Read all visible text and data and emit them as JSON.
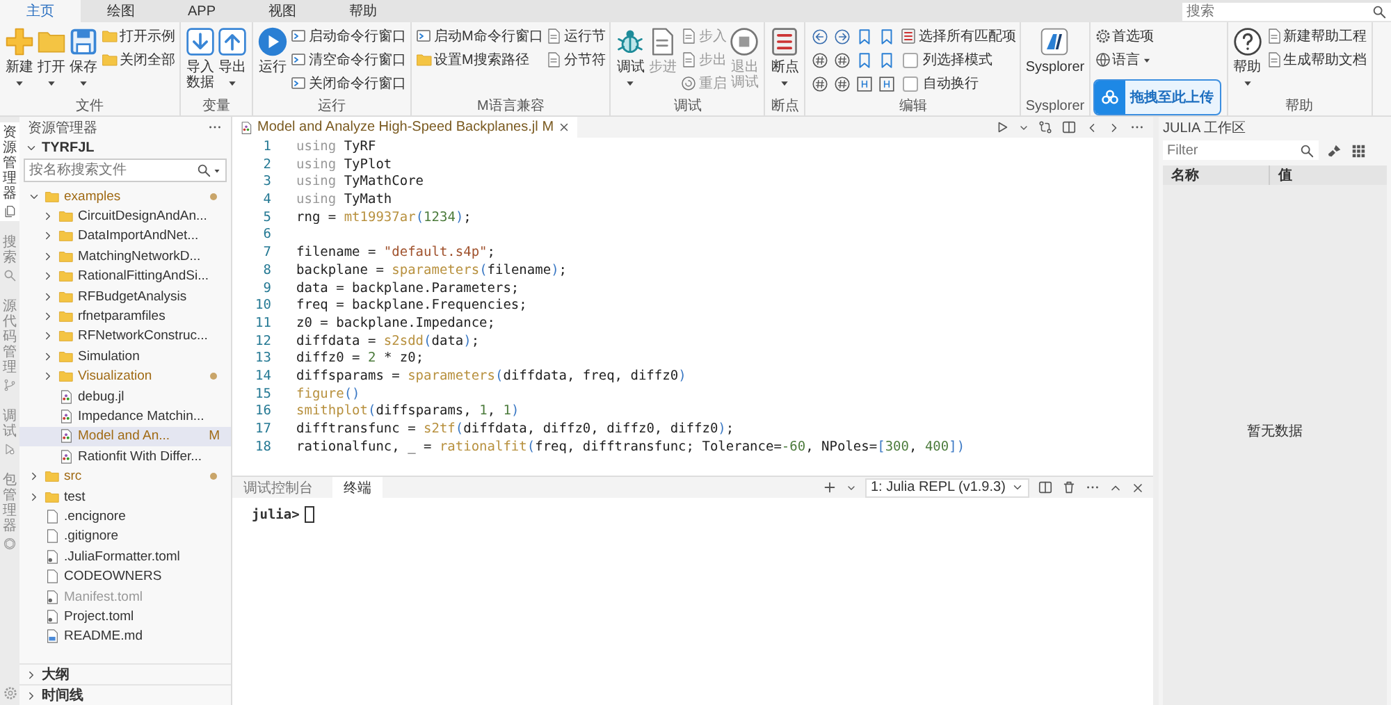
{
  "menu_tabs": [
    {
      "label": "主页",
      "selected": true
    },
    {
      "label": "绘图",
      "selected": false
    },
    {
      "label": "APP",
      "selected": false
    },
    {
      "label": "视图",
      "selected": false
    },
    {
      "label": "帮助",
      "selected": false
    }
  ],
  "search": {
    "placeholder": "搜索"
  },
  "ribbon": {
    "groups": [
      {
        "label": "文件",
        "columns": [
          {
            "kind": "large",
            "items": [
              {
                "label": "新建",
                "dropdown": true,
                "disabled": false
              },
              {
                "label": "打开",
                "dropdown": true,
                "disabled": false
              },
              {
                "label": "保存",
                "dropdown": true,
                "disabled": false
              }
            ]
          },
          {
            "kind": "small",
            "items": [
              {
                "label": "打开示例",
                "disabled": false
              },
              {
                "label": "关闭全部",
                "disabled": false
              }
            ]
          }
        ]
      },
      {
        "label": "变量",
        "columns": [
          {
            "kind": "large",
            "items": [
              {
                "label": "导入数据",
                "disabled": false
              },
              {
                "label": "导出",
                "dropdown": true,
                "disabled": false
              }
            ]
          }
        ]
      },
      {
        "label": "运行",
        "columns": [
          {
            "kind": "large",
            "items": [
              {
                "label": "运行",
                "disabled": false
              }
            ]
          },
          {
            "kind": "small",
            "items": [
              {
                "label": "启动命令行窗口",
                "disabled": false
              },
              {
                "label": "清空命令行窗口",
                "disabled": false
              },
              {
                "label": "关闭命令行窗口",
                "disabled": false
              }
            ]
          }
        ]
      },
      {
        "label": "M语言兼容",
        "columns": [
          {
            "kind": "small",
            "items": [
              {
                "label": "启动M命令行窗口",
                "disabled": false
              },
              {
                "label": "设置M搜索路径",
                "disabled": false
              }
            ]
          },
          {
            "kind": "small",
            "items": [
              {
                "label": "运行节",
                "disabled": false
              },
              {
                "label": "分节符",
                "disabled": false
              }
            ]
          }
        ]
      },
      {
        "label": "调试",
        "columns": [
          {
            "kind": "large",
            "items": [
              {
                "label": "调试",
                "dropdown": true,
                "disabled": false
              },
              {
                "label": "步进",
                "disabled": true
              }
            ]
          },
          {
            "kind": "small",
            "items": [
              {
                "label": "步入",
                "disabled": true
              },
              {
                "label": "步出",
                "disabled": true
              },
              {
                "label": "重启",
                "disabled": true
              }
            ]
          },
          {
            "kind": "large",
            "items": [
              {
                "label": "退出调试",
                "disabled": true
              }
            ]
          }
        ]
      },
      {
        "label": "断点",
        "columns": [
          {
            "kind": "large",
            "items": [
              {
                "label": "断点",
                "dropdown": true,
                "disabled": false
              }
            ]
          }
        ]
      },
      {
        "label": "编辑",
        "columns": [
          {
            "kind": "icons"
          },
          {
            "kind": "small",
            "items": [
              {
                "kind": "button",
                "label": "选择所有匹配项",
                "disabled": false
              },
              {
                "kind": "check",
                "label": "列选择模式",
                "checked": false
              },
              {
                "kind": "check",
                "label": "自动换行",
                "checked": false
              }
            ]
          }
        ]
      },
      {
        "label": "Sysplorer",
        "columns": [
          {
            "kind": "large",
            "items": [
              {
                "label": "Sysplorer",
                "disabled": false
              }
            ]
          }
        ]
      },
      {
        "columns": [
          {
            "kind": "small",
            "items": [
              {
                "label": "首选项",
                "disabled": false
              },
              {
                "label": "语言",
                "dropdown": true,
                "disabled": false
              }
            ]
          }
        ]
      },
      {
        "label": "帮助",
        "columns": [
          {
            "kind": "large",
            "items": [
              {
                "label": "帮助",
                "dropdown": true,
                "disabled": false
              }
            ]
          },
          {
            "kind": "small",
            "items": [
              {
                "label": "新建帮助工程",
                "disabled": false
              },
              {
                "label": "生成帮助文档",
                "disabled": false
              }
            ]
          }
        ]
      }
    ]
  },
  "upload_badge": {
    "label": "拖拽至此上传"
  },
  "activity_bar": [
    {
      "label": "资源管理器",
      "selected": true
    },
    {
      "label": "搜索",
      "selected": false
    },
    {
      "label": "源代码管理",
      "selected": false
    },
    {
      "label": "调试",
      "selected": false
    },
    {
      "label": "包管理器",
      "selected": false
    }
  ],
  "explorer": {
    "title": "资源管理器",
    "root": {
      "label": "TYRFJL",
      "expanded": true
    },
    "search": {
      "placeholder": "按名称搜索文件"
    },
    "tree": [
      {
        "kind": "folder",
        "label": "examples",
        "expanded": true,
        "selected": false,
        "modified": true,
        "dimmed": false,
        "children": [
          {
            "kind": "folder",
            "label": "CircuitDesignAndAn...",
            "expanded": false,
            "selected": false,
            "modified": false,
            "dimmed": false
          },
          {
            "kind": "folder",
            "label": "DataImportAndNet...",
            "expanded": false,
            "selected": false,
            "modified": false,
            "dimmed": false
          },
          {
            "kind": "folder",
            "label": "MatchingNetworkD...",
            "expanded": false,
            "selected": false,
            "modified": false,
            "dimmed": false
          },
          {
            "kind": "folder",
            "label": "RationalFittingAndSi...",
            "expanded": false,
            "selected": false,
            "modified": false,
            "dimmed": false
          },
          {
            "kind": "folder",
            "label": "RFBudgetAnalysis",
            "expanded": false,
            "selected": false,
            "modified": false,
            "dimmed": false
          },
          {
            "kind": "folder",
            "label": "rfnetparamfiles",
            "expanded": false,
            "selected": false,
            "modified": false,
            "dimmed": false
          },
          {
            "kind": "folder",
            "label": "RFNetworkConstruc...",
            "expanded": false,
            "selected": false,
            "modified": false,
            "dimmed": false
          },
          {
            "kind": "folder",
            "label": "Simulation",
            "expanded": false,
            "selected": false,
            "modified": false,
            "dimmed": false
          },
          {
            "kind": "folder",
            "label": "Visualization",
            "expanded": false,
            "selected": false,
            "modified": true,
            "dimmed": false
          },
          {
            "kind": "julia",
            "label": "debug.jl",
            "selected": false,
            "modified": false,
            "dimmed": false
          },
          {
            "kind": "julia",
            "label": "Impedance Matchin...",
            "selected": false,
            "modified": false,
            "dimmed": false
          },
          {
            "kind": "julia",
            "label": "Model and An...",
            "badge": "M",
            "selected": true,
            "modified": true,
            "dimmed": false
          },
          {
            "kind": "julia",
            "label": "Rationfit With Differ...",
            "selected": false,
            "modified": false,
            "dimmed": false
          }
        ]
      },
      {
        "kind": "folder",
        "label": "src",
        "expanded": false,
        "selected": false,
        "modified": true,
        "dimmed": false
      },
      {
        "kind": "folder",
        "label": "test",
        "expanded": false,
        "selected": false,
        "modified": false,
        "dimmed": false
      },
      {
        "kind": "file",
        "label": ".encignore",
        "selected": false,
        "modified": false,
        "dimmed": false
      },
      {
        "kind": "file",
        "label": ".gitignore",
        "selected": false,
        "modified": false,
        "dimmed": false
      },
      {
        "kind": "config",
        "label": ".JuliaFormatter.toml",
        "selected": false,
        "modified": false,
        "dimmed": false
      },
      {
        "kind": "file",
        "label": "CODEOWNERS",
        "selected": false,
        "modified": false,
        "dimmed": false
      },
      {
        "kind": "config",
        "label": "Manifest.toml",
        "selected": false,
        "modified": false,
        "dimmed": true
      },
      {
        "kind": "config",
        "label": "Project.toml",
        "selected": false,
        "modified": false,
        "dimmed": false
      },
      {
        "kind": "markdown",
        "label": "README.md",
        "selected": false,
        "modified": false,
        "dimmed": false
      }
    ],
    "sections": [
      {
        "label": "大纲",
        "expanded": false
      },
      {
        "label": "时间线",
        "expanded": false
      }
    ]
  },
  "editor": {
    "tab": {
      "title": "Model and Analyze High-Speed Backplanes.jl",
      "badge": "M"
    },
    "lines": [
      {
        "number": "1",
        "tokens": [
          {
            "kind": "kw",
            "text": "using"
          },
          {
            "kind": "plain",
            "text": " TyRF"
          }
        ]
      },
      {
        "number": "2",
        "tokens": [
          {
            "kind": "kw",
            "text": "using"
          },
          {
            "kind": "plain",
            "text": " TyPlot"
          }
        ]
      },
      {
        "number": "3",
        "tokens": [
          {
            "kind": "kw",
            "text": "using"
          },
          {
            "kind": "plain",
            "text": " TyMathCore"
          }
        ]
      },
      {
        "number": "4",
        "tokens": [
          {
            "kind": "kw",
            "text": "using"
          },
          {
            "kind": "plain",
            "text": " TyMath"
          }
        ]
      },
      {
        "number": "5",
        "tokens": [
          {
            "kind": "plain",
            "text": "rng = "
          },
          {
            "kind": "fn",
            "text": "mt19937ar"
          },
          {
            "kind": "paren",
            "text": "("
          },
          {
            "kind": "num",
            "text": "1234"
          },
          {
            "kind": "paren",
            "text": ")"
          },
          {
            "kind": "plain",
            "text": ";"
          }
        ]
      },
      {
        "number": "6"
      },
      {
        "number": "7",
        "tokens": [
          {
            "kind": "plain",
            "text": "filename = "
          },
          {
            "kind": "str",
            "text": "\"default.s4p\""
          },
          {
            "kind": "plain",
            "text": ";"
          }
        ]
      },
      {
        "number": "8",
        "tokens": [
          {
            "kind": "plain",
            "text": "backplane = "
          },
          {
            "kind": "fn",
            "text": "sparameters"
          },
          {
            "kind": "paren",
            "text": "("
          },
          {
            "kind": "plain",
            "text": "filename"
          },
          {
            "kind": "paren",
            "text": ")"
          },
          {
            "kind": "plain",
            "text": ";"
          }
        ]
      },
      {
        "number": "9",
        "tokens": [
          {
            "kind": "plain",
            "text": "data = backplane.Parameters;"
          }
        ]
      },
      {
        "number": "10",
        "tokens": [
          {
            "kind": "plain",
            "text": "freq = backplane.Frequencies;"
          }
        ]
      },
      {
        "number": "11",
        "tokens": [
          {
            "kind": "plain",
            "text": "z0 = backplane.Impedance;"
          }
        ]
      },
      {
        "number": "12",
        "tokens": [
          {
            "kind": "plain",
            "text": "diffdata = "
          },
          {
            "kind": "fn",
            "text": "s2sdd"
          },
          {
            "kind": "paren",
            "text": "("
          },
          {
            "kind": "plain",
            "text": "data"
          },
          {
            "kind": "paren",
            "text": ")"
          },
          {
            "kind": "plain",
            "text": ";"
          }
        ]
      },
      {
        "number": "13",
        "tokens": [
          {
            "kind": "plain",
            "text": "diffz0 = "
          },
          {
            "kind": "num",
            "text": "2"
          },
          {
            "kind": "plain",
            "text": " * z0;"
          }
        ]
      },
      {
        "number": "14",
        "tokens": [
          {
            "kind": "plain",
            "text": "diffsparams = "
          },
          {
            "kind": "fn",
            "text": "sparameters"
          },
          {
            "kind": "paren",
            "text": "("
          },
          {
            "kind": "plain",
            "text": "diffdata, freq, diffz0"
          },
          {
            "kind": "paren",
            "text": ")"
          }
        ]
      },
      {
        "number": "15",
        "tokens": [
          {
            "kind": "fn",
            "text": "figure"
          },
          {
            "kind": "paren",
            "text": "()"
          }
        ]
      },
      {
        "number": "16",
        "tokens": [
          {
            "kind": "fn",
            "text": "smithplot"
          },
          {
            "kind": "paren",
            "text": "("
          },
          {
            "kind": "plain",
            "text": "diffsparams, "
          },
          {
            "kind": "num",
            "text": "1"
          },
          {
            "kind": "plain",
            "text": ", "
          },
          {
            "kind": "num",
            "text": "1"
          },
          {
            "kind": "paren",
            "text": ")"
          }
        ]
      },
      {
        "number": "17",
        "tokens": [
          {
            "kind": "plain",
            "text": "difftransfunc = "
          },
          {
            "kind": "fn",
            "text": "s2tf"
          },
          {
            "kind": "paren",
            "text": "("
          },
          {
            "kind": "plain",
            "text": "diffdata, diffz0, diffz0, diffz0"
          },
          {
            "kind": "paren",
            "text": ")"
          },
          {
            "kind": "plain",
            "text": ";"
          }
        ]
      },
      {
        "number": "18",
        "tokens": [
          {
            "kind": "plain",
            "text": "rationalfunc, _ = "
          },
          {
            "kind": "fn",
            "text": "rationalfit"
          },
          {
            "kind": "paren",
            "text": "("
          },
          {
            "kind": "plain",
            "text": "freq, difftransfunc; Tolerance="
          },
          {
            "kind": "num",
            "text": "-60"
          },
          {
            "kind": "plain",
            "text": ", NPoles="
          },
          {
            "kind": "paren",
            "text": "["
          },
          {
            "kind": "num",
            "text": "300"
          },
          {
            "kind": "plain",
            "text": ", "
          },
          {
            "kind": "num",
            "text": "400"
          },
          {
            "kind": "paren",
            "text": "])"
          }
        ]
      }
    ]
  },
  "panel": {
    "tabs": [
      {
        "label": "调试控制台",
        "selected": false
      },
      {
        "label": "终端",
        "selected": true
      }
    ],
    "terminal_select": {
      "value": "1: Julia REPL (v1.9.3)"
    },
    "prompt": "julia>"
  },
  "workspace": {
    "title": "JULIA 工作区",
    "filter": {
      "placeholder": "Filter"
    },
    "columns": [
      "名称",
      "值"
    ],
    "empty_text": "暂无数据"
  }
}
